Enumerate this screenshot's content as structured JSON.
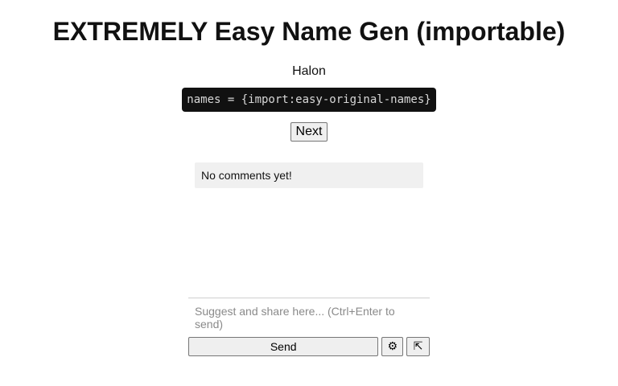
{
  "header": {
    "title": "EXTREMELY Easy Name Gen (importable)"
  },
  "generator": {
    "output": "Halon",
    "code": "names = {import:easy-original-names}",
    "next_label": "Next"
  },
  "comments": {
    "empty_text": "No comments yet!"
  },
  "composer": {
    "placeholder": "Suggest and share here... (Ctrl+Enter to send)",
    "send_label": "Send",
    "settings_icon": "⚙",
    "expand_icon": "⇱"
  }
}
